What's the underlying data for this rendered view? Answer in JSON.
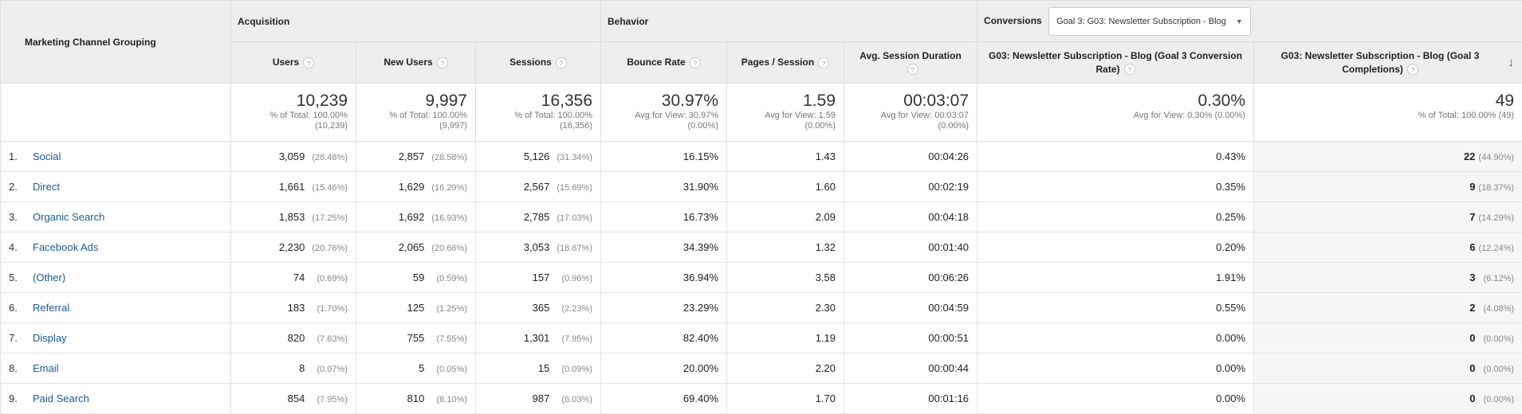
{
  "header": {
    "dimension": "Marketing Channel Grouping",
    "groups": {
      "acquisition": "Acquisition",
      "behavior": "Behavior",
      "conversions": "Conversions"
    },
    "goal_select": "Goal 3: G03: Newsletter Subscription - Blog",
    "question_mark": "?",
    "sort_arrow": "↓",
    "dropdown_caret": "▼",
    "columns": {
      "users": "Users",
      "new_users": "New Users",
      "sessions": "Sessions",
      "bounce_rate": "Bounce Rate",
      "pages_session": "Pages / Session",
      "avg_duration": "Avg. Session Duration",
      "conv_rate": "G03: Newsletter Subscription - Blog (Goal 3 Conversion Rate)",
      "completions": "G03: Newsletter Subscription - Blog (Goal 3 Completions)"
    }
  },
  "totals": {
    "users": {
      "value": "10,239",
      "sub1": "% of Total: 100.00%",
      "sub2": "(10,239)"
    },
    "new_users": {
      "value": "9,997",
      "sub1": "% of Total: 100.00%",
      "sub2": "(9,997)"
    },
    "sessions": {
      "value": "16,356",
      "sub1": "% of Total: 100.00%",
      "sub2": "(16,356)"
    },
    "bounce_rate": {
      "value": "30.97%",
      "sub1": "Avg for View: 30.97%",
      "sub2": "(0.00%)"
    },
    "pages_session": {
      "value": "1.59",
      "sub1": "Avg for View: 1.59",
      "sub2": "(0.00%)"
    },
    "avg_duration": {
      "value": "00:03:07",
      "sub1": "Avg for View: 00:03:07",
      "sub2": "(0.00%)"
    },
    "conv_rate": {
      "value": "0.30%",
      "sub1": "Avg for View: 0.30% (0.00%)"
    },
    "completions": {
      "value": "49",
      "sub1": "% of Total: 100.00% (49)"
    }
  },
  "rows": [
    {
      "idx": "1.",
      "name": "Social",
      "users": "3,059",
      "users_pct": "(28.48%)",
      "new_users": "2,857",
      "new_users_pct": "(28.58%)",
      "sessions": "5,126",
      "sessions_pct": "(31.34%)",
      "bounce": "16.15%",
      "pps": "1.43",
      "dur": "00:04:26",
      "conv": "0.43%",
      "comp": "22",
      "comp_pct": "(44.90%)"
    },
    {
      "idx": "2.",
      "name": "Direct",
      "users": "1,661",
      "users_pct": "(15.46%)",
      "new_users": "1,629",
      "new_users_pct": "(16.29%)",
      "sessions": "2,567",
      "sessions_pct": "(15.69%)",
      "bounce": "31.90%",
      "pps": "1.60",
      "dur": "00:02:19",
      "conv": "0.35%",
      "comp": "9",
      "comp_pct": "(18.37%)"
    },
    {
      "idx": "3.",
      "name": "Organic Search",
      "users": "1,853",
      "users_pct": "(17.25%)",
      "new_users": "1,692",
      "new_users_pct": "(16.93%)",
      "sessions": "2,785",
      "sessions_pct": "(17.03%)",
      "bounce": "16.73%",
      "pps": "2.09",
      "dur": "00:04:18",
      "conv": "0.25%",
      "comp": "7",
      "comp_pct": "(14.29%)"
    },
    {
      "idx": "4.",
      "name": "Facebook Ads",
      "users": "2,230",
      "users_pct": "(20.76%)",
      "new_users": "2,065",
      "new_users_pct": "(20.66%)",
      "sessions": "3,053",
      "sessions_pct": "(18.67%)",
      "bounce": "34.39%",
      "pps": "1.32",
      "dur": "00:01:40",
      "conv": "0.20%",
      "comp": "6",
      "comp_pct": "(12.24%)"
    },
    {
      "idx": "5.",
      "name": "(Other)",
      "users": "74",
      "users_pct": "(0.69%)",
      "new_users": "59",
      "new_users_pct": "(0.59%)",
      "sessions": "157",
      "sessions_pct": "(0.96%)",
      "bounce": "36.94%",
      "pps": "3.58",
      "dur": "00:06:26",
      "conv": "1.91%",
      "comp": "3",
      "comp_pct": "(6.12%)"
    },
    {
      "idx": "6.",
      "name": "Referral",
      "users": "183",
      "users_pct": "(1.70%)",
      "new_users": "125",
      "new_users_pct": "(1.25%)",
      "sessions": "365",
      "sessions_pct": "(2.23%)",
      "bounce": "23.29%",
      "pps": "2.30",
      "dur": "00:04:59",
      "conv": "0.55%",
      "comp": "2",
      "comp_pct": "(4.08%)"
    },
    {
      "idx": "7.",
      "name": "Display",
      "users": "820",
      "users_pct": "(7.63%)",
      "new_users": "755",
      "new_users_pct": "(7.55%)",
      "sessions": "1,301",
      "sessions_pct": "(7.95%)",
      "bounce": "82.40%",
      "pps": "1.19",
      "dur": "00:00:51",
      "conv": "0.00%",
      "comp": "0",
      "comp_pct": "(0.00%)"
    },
    {
      "idx": "8.",
      "name": "Email",
      "users": "8",
      "users_pct": "(0.07%)",
      "new_users": "5",
      "new_users_pct": "(0.05%)",
      "sessions": "15",
      "sessions_pct": "(0.09%)",
      "bounce": "20.00%",
      "pps": "2.20",
      "dur": "00:00:44",
      "conv": "0.00%",
      "comp": "0",
      "comp_pct": "(0.00%)"
    },
    {
      "idx": "9.",
      "name": "Paid Search",
      "users": "854",
      "users_pct": "(7.95%)",
      "new_users": "810",
      "new_users_pct": "(8.10%)",
      "sessions": "987",
      "sessions_pct": "(6.03%)",
      "bounce": "69.40%",
      "pps": "1.70",
      "dur": "00:01:16",
      "conv": "0.00%",
      "comp": "0",
      "comp_pct": "(0.00%)"
    }
  ]
}
